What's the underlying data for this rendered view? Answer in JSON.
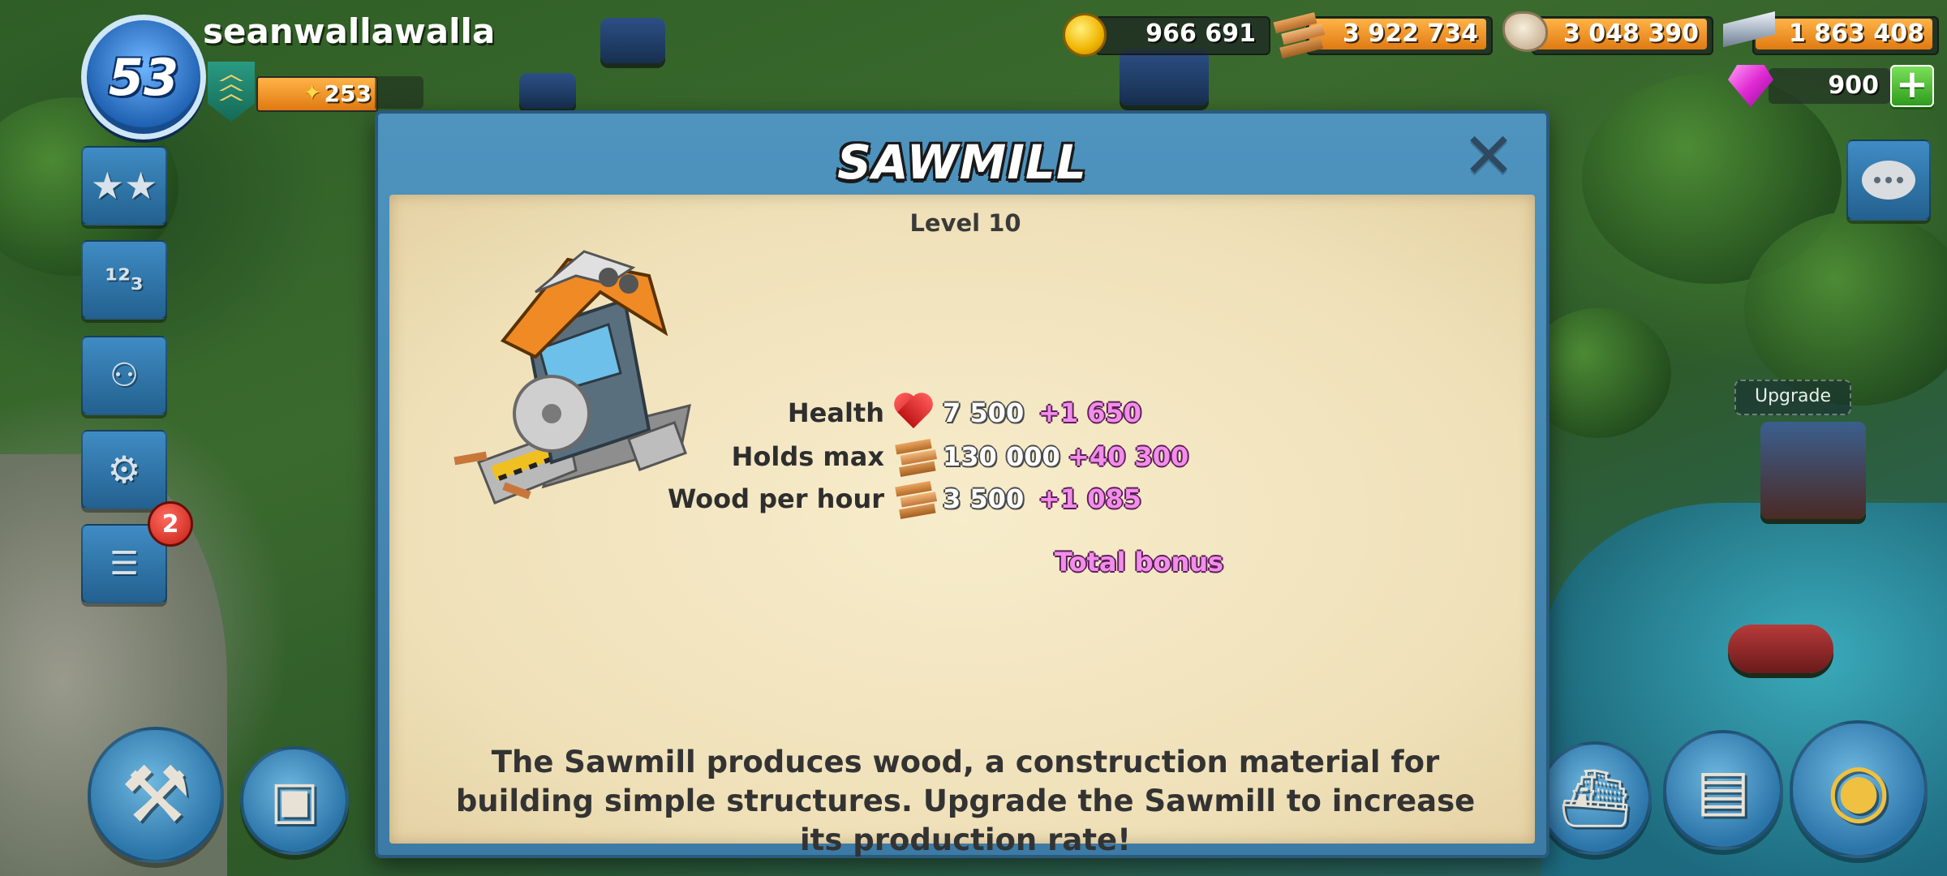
{
  "player": {
    "level": "53",
    "name": "seanwallawalla",
    "rank_points": "253"
  },
  "resources": {
    "gold": "966 691",
    "wood": "3 922 734",
    "stone": "3 048 390",
    "iron": "1 863 408",
    "diamonds": "900",
    "add_label": "+"
  },
  "sidebar": {
    "notification_count": "2"
  },
  "world": {
    "upgrade_tag": "Upgrade"
  },
  "dialog": {
    "title": "SAWMILL",
    "close_label": "✕",
    "level": "Level 10",
    "stats": [
      {
        "label": "Health",
        "icon": "heart-icon",
        "value": "7 500",
        "bonus": "+1 650"
      },
      {
        "label": "Holds max",
        "icon": "wood-icon",
        "value": "130 000",
        "bonus": "+40 300"
      },
      {
        "label": "Wood per hour",
        "icon": "wood-icon",
        "value": "3 500",
        "bonus": "+1 085"
      }
    ],
    "total_bonus": "Total bonus",
    "description": "The Sawmill produces wood, a construction material for building simple structures. Upgrade the Sawmill to increase its production rate!"
  },
  "colors": {
    "dialog_frame": "#3c7ba6",
    "paper": "#f3e6c2",
    "bonus_text": "#f28de9",
    "resource_bar": "#f0962a"
  }
}
